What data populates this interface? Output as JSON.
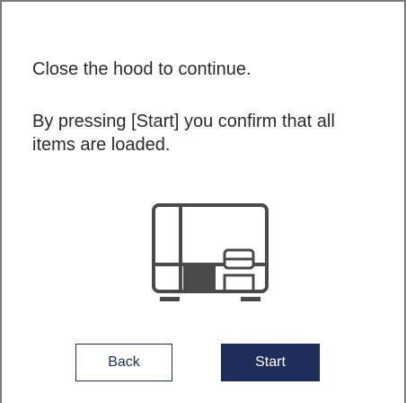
{
  "dialog": {
    "message_line1": "Close the hood to continue.",
    "message_line2": "By pressing [Start] you confirm that all items are loaded.",
    "illustration_icon": "instrument-hood-closed-icon",
    "back_label": "Back",
    "start_label": "Start"
  },
  "colors": {
    "primary": "#1f2d5a",
    "text": "#2b2b2b",
    "icon": "#4a4a4a",
    "border": "#7a7a7a"
  }
}
